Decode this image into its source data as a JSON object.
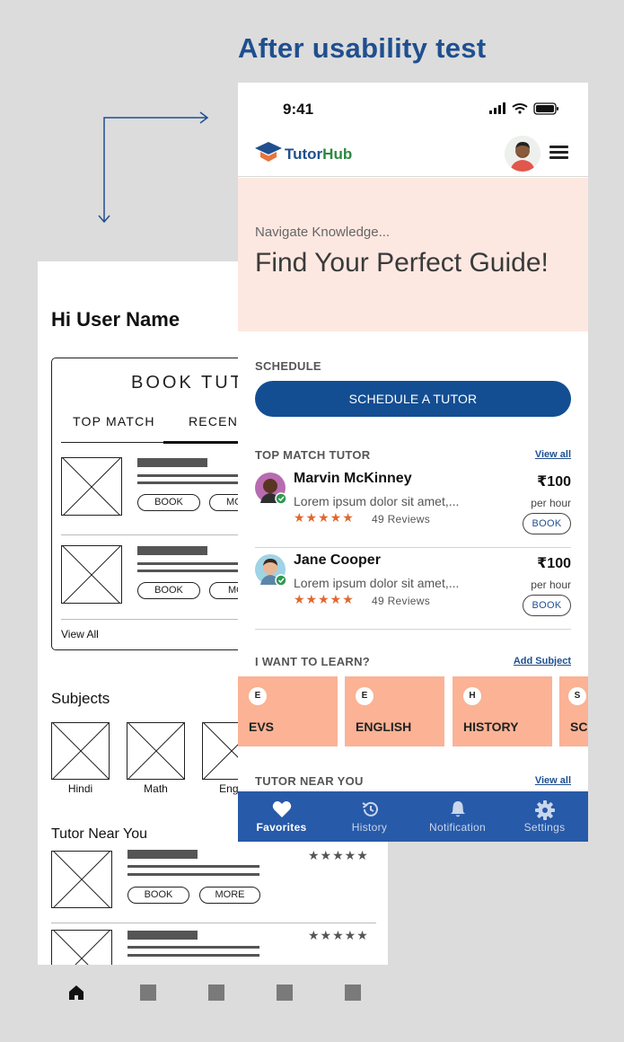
{
  "page_heading": "After usability test",
  "wireframe": {
    "greeting": "Hi User Name",
    "book_title": "BOOK TUT",
    "tabs": [
      "TOP MATCH",
      "RECENT"
    ],
    "book_button": "BOOK",
    "more_button_1": "MO",
    "more_button_2": "MO",
    "view_all": "View All",
    "subjects_title": "Subjects",
    "subjects": [
      "Hindi",
      "Math",
      "Engli"
    ],
    "tutor_near_title": "Tutor Near You",
    "near_book": "BOOK",
    "near_more": "MORE",
    "stars": "★★★★★"
  },
  "phone": {
    "status": {
      "time": "9:41"
    },
    "brand": {
      "name_part1": "Tutor",
      "name_part2": "Hub"
    },
    "hero": {
      "subtitle": "Navigate Knowledge...",
      "title": "Find Your Perfect Guide!"
    },
    "schedule": {
      "label": "SCHEDULE",
      "button": "SCHEDULE A TUTOR"
    },
    "top_match": {
      "label": "TOP MATCH TUTOR",
      "link": "View all",
      "tutors": [
        {
          "name": "Marvin McKinney",
          "desc": "Lorem ipsum dolor sit amet,...",
          "stars": "★★★★★",
          "reviews": "49 Reviews",
          "price": "₹100",
          "per": "per hour",
          "book": "BOOK"
        },
        {
          "name": "Jane Cooper",
          "desc": "Lorem ipsum dolor sit amet,...",
          "stars": "★★★★★",
          "reviews": "49 Reviews",
          "price": "₹100",
          "per": "per hour",
          "book": "BOOK"
        }
      ]
    },
    "learn": {
      "label": "I WANT TO LEARN?",
      "link": "Add Subject",
      "subjects": [
        {
          "letter": "E",
          "name": "EVS"
        },
        {
          "letter": "E",
          "name": "ENGLISH"
        },
        {
          "letter": "H",
          "name": "HISTORY"
        },
        {
          "letter": "S",
          "name": "SCI"
        }
      ]
    },
    "near": {
      "label": "TUTOR NEAR YOU",
      "link": "View all"
    },
    "tabbar": [
      {
        "label": "Favorites",
        "icon": "heart-icon",
        "active": true
      },
      {
        "label": "History",
        "icon": "history-icon",
        "active": false
      },
      {
        "label": "Notification",
        "icon": "bell-icon",
        "active": false
      },
      {
        "label": "Settings",
        "icon": "gear-icon",
        "active": false
      }
    ],
    "colors": {
      "primary": "#134e93",
      "tabbar": "#275aa8",
      "hero_bg": "#fde8e1",
      "subject_bg": "#fbb295",
      "star": "#e2682d"
    }
  }
}
